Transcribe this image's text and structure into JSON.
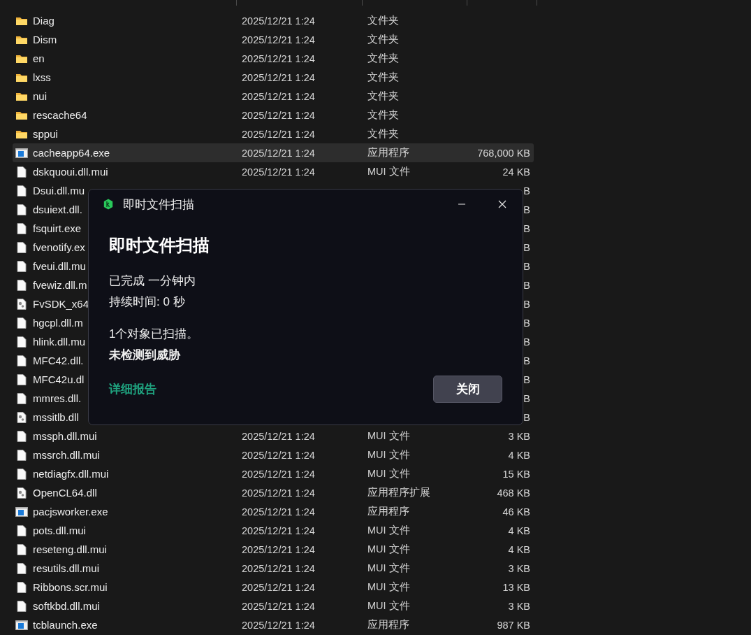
{
  "files": [
    {
      "kind": "folder",
      "name": "Diag",
      "date": "2025/12/21 1:24",
      "type": "文件夹",
      "selected": false
    },
    {
      "kind": "folder",
      "name": "Dism",
      "date": "2025/12/21 1:24",
      "type": "文件夹",
      "selected": false
    },
    {
      "kind": "folder",
      "name": "en",
      "date": "2025/12/21 1:24",
      "type": "文件夹",
      "selected": false
    },
    {
      "kind": "folder",
      "name": "lxss",
      "date": "2025/12/21 1:24",
      "type": "文件夹",
      "selected": false
    },
    {
      "kind": "folder",
      "name": "nui",
      "date": "2025/12/21 1:24",
      "type": "文件夹",
      "selected": false
    },
    {
      "kind": "folder",
      "name": "rescache64",
      "date": "2025/12/21 1:24",
      "type": "文件夹",
      "selected": false
    },
    {
      "kind": "folder",
      "name": "sppui",
      "date": "2025/12/21 1:24",
      "type": "文件夹",
      "selected": false
    },
    {
      "kind": "exe",
      "name": "cacheapp64.exe",
      "date": "2025/12/21 1:24",
      "type": "应用程序",
      "size": "768,000 KB",
      "selected": true
    },
    {
      "kind": "file",
      "name": "dskquoui.dll.mui",
      "date": "2025/12/21 1:24",
      "type": "MUI 文件",
      "size": "24 KB",
      "selected": false
    },
    {
      "kind": "file",
      "name": "Dsui.dll.mu",
      "size": "B",
      "selected": false
    },
    {
      "kind": "file",
      "name": "dsuiext.dll.",
      "size": "B",
      "selected": false
    },
    {
      "kind": "file",
      "name": "fsquirt.exe",
      "size": "B",
      "selected": false
    },
    {
      "kind": "file",
      "name": "fvenotify.ex",
      "size": "B",
      "selected": false
    },
    {
      "kind": "file",
      "name": "fveui.dll.mu",
      "size": "B",
      "selected": false
    },
    {
      "kind": "file",
      "name": "fvewiz.dll.m",
      "size": "B",
      "selected": false
    },
    {
      "kind": "dll",
      "name": "FvSDK_x64",
      "size": "B",
      "selected": false
    },
    {
      "kind": "file",
      "name": "hgcpl.dll.m",
      "size": "B",
      "selected": false
    },
    {
      "kind": "file",
      "name": "hlink.dll.mu",
      "size": "B",
      "selected": false
    },
    {
      "kind": "file",
      "name": "MFC42.dll.",
      "size": "B",
      "selected": false
    },
    {
      "kind": "file",
      "name": "MFC42u.dl",
      "size": "B",
      "selected": false
    },
    {
      "kind": "file",
      "name": "mmres.dll.",
      "size": "B",
      "selected": false
    },
    {
      "kind": "dll",
      "name": "mssitlb.dll",
      "size": "B",
      "selected": false
    },
    {
      "kind": "file",
      "name": "mssph.dll.mui",
      "date": "2025/12/21 1:24",
      "type": "MUI 文件",
      "size": "3 KB",
      "selected": false
    },
    {
      "kind": "file",
      "name": "mssrch.dll.mui",
      "date": "2025/12/21 1:24",
      "type": "MUI 文件",
      "size": "4 KB",
      "selected": false
    },
    {
      "kind": "file",
      "name": "netdiagfx.dll.mui",
      "date": "2025/12/21 1:24",
      "type": "MUI 文件",
      "size": "15 KB",
      "selected": false
    },
    {
      "kind": "dll",
      "name": "OpenCL64.dll",
      "date": "2025/12/21 1:24",
      "type": "应用程序扩展",
      "size": "468 KB",
      "selected": false
    },
    {
      "kind": "exe",
      "name": "pacjsworker.exe",
      "date": "2025/12/21 1:24",
      "type": "应用程序",
      "size": "46 KB",
      "selected": false
    },
    {
      "kind": "file",
      "name": "pots.dll.mui",
      "date": "2025/12/21 1:24",
      "type": "MUI 文件",
      "size": "4 KB",
      "selected": false
    },
    {
      "kind": "file",
      "name": "reseteng.dll.mui",
      "date": "2025/12/21 1:24",
      "type": "MUI 文件",
      "size": "4 KB",
      "selected": false
    },
    {
      "kind": "file",
      "name": "resutils.dll.mui",
      "date": "2025/12/21 1:24",
      "type": "MUI 文件",
      "size": "3 KB",
      "selected": false
    },
    {
      "kind": "file",
      "name": "Ribbons.scr.mui",
      "date": "2025/12/21 1:24",
      "type": "MUI 文件",
      "size": "13 KB",
      "selected": false
    },
    {
      "kind": "file",
      "name": "softkbd.dll.mui",
      "date": "2025/12/21 1:24",
      "type": "MUI 文件",
      "size": "3 KB",
      "selected": false
    },
    {
      "kind": "exe",
      "name": "tcblaunch.exe",
      "date": "2025/12/21 1:24",
      "type": "应用程序",
      "size": "987 KB",
      "selected": false
    }
  ],
  "dialog": {
    "title": "即时文件扫描",
    "heading": "即时文件扫描",
    "lines": [
      "已完成 一分钟内",
      "持续时间: 0 秒"
    ],
    "result": "1个对象已扫描。",
    "verdict": "未检测到威胁",
    "link": "详细报告",
    "button": "关闭"
  }
}
